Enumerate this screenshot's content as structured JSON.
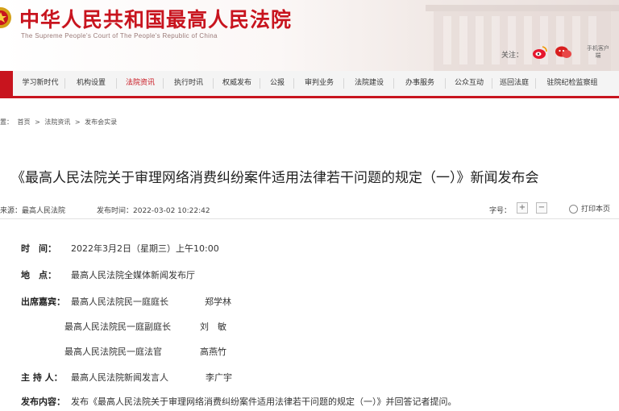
{
  "header": {
    "site_title": "中华人民共和国最高人民法院",
    "site_subtitle": "The Supreme People's Court of The People's Republic of China",
    "follow_label": "关注：",
    "mobile_label": "手机客户端",
    "brand_color": "#c8141e",
    "icons": [
      "court-emblem-icon",
      "weibo-icon",
      "wechat-icon"
    ]
  },
  "nav": {
    "items": [
      {
        "label": "学习新时代"
      },
      {
        "label": "机构设置"
      },
      {
        "label": "法院资讯",
        "active": true
      },
      {
        "label": "执行时讯"
      },
      {
        "label": "权威发布"
      },
      {
        "label": "公报"
      },
      {
        "label": "审判业务"
      },
      {
        "label": "法院建设"
      },
      {
        "label": "办事服务"
      },
      {
        "label": "公众互动"
      },
      {
        "label": "巡回法庭"
      },
      {
        "label": "驻院纪检监察组"
      }
    ]
  },
  "breadcrumb": {
    "prefix": "置：",
    "items": [
      "首页",
      "法院资讯",
      "发布会实录"
    ],
    "separator": ">"
  },
  "article": {
    "title": "《最高人民法院关于审理网络消费纠纷案件适用法律若干问题的规定（一）》新闻发布会",
    "source": "来源：最高人民法院",
    "publish_time": "发布时间：2022-03-02 10:22:42",
    "font_size_label": "字号：",
    "font_plus": "+",
    "font_minus": "−",
    "print_label": "打印本页"
  },
  "details": {
    "time_label": "时　间：",
    "time_value": "2022年3月2日（星期三）上午10:00",
    "place_label": "地　点：",
    "place_value": "最高人民法院全媒体新闻发布厅",
    "guests_label": "出席嘉宾：",
    "guests": [
      {
        "org": "最高人民法院民一庭庭长",
        "name": "郑学林"
      },
      {
        "org": "最高人民法院民一庭副庭长",
        "name": "刘　敏"
      },
      {
        "org": "最高人民法院民一庭法官",
        "name": "高燕竹"
      }
    ],
    "host_label": "主 持 人：",
    "host_value": "最高人民法院新闻发言人",
    "host_name": "李广宇",
    "content_label": "发布内容：",
    "content_value": "发布《最高人民法院关于审理网络消费纠纷案件适用法律若干问题的规定（一）》并回答记者提问。"
  }
}
